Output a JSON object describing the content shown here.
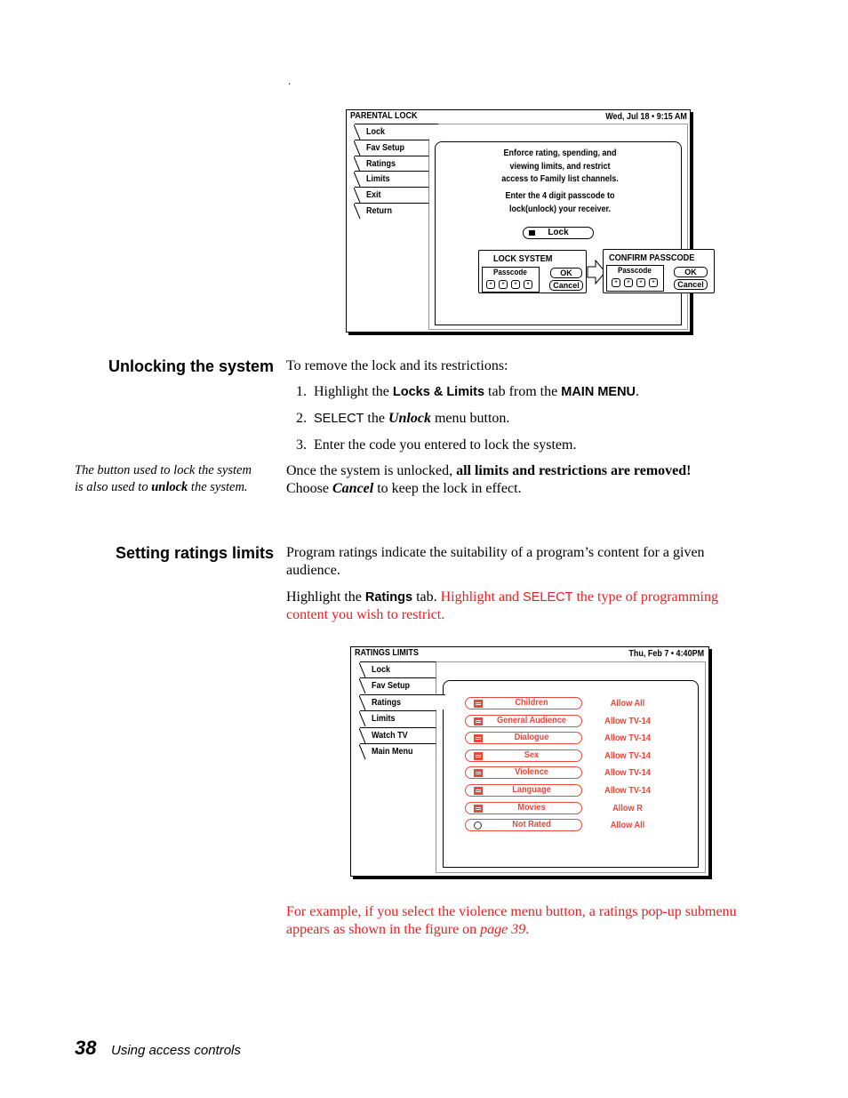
{
  "stray_mark": ".",
  "parental_lock_screen": {
    "title": "PARENTAL LOCK",
    "datetime": "Wed, Jul 18  •  9:15 AM",
    "tabs": [
      {
        "label": "Lock",
        "active": true
      },
      {
        "label": "Fav Setup"
      },
      {
        "label": "Ratings"
      },
      {
        "label": "Limits"
      },
      {
        "label": "Exit"
      },
      {
        "label": "Return"
      }
    ],
    "info_lines": [
      "Enforce rating, spending, and",
      "viewing limits, and restrict",
      "access to Family list channels."
    ],
    "passcode_lines": [
      "Enter the 4 digit passcode to",
      "lock(unlock) your receiver."
    ],
    "lock_button": "Lock",
    "lock_dialog": {
      "title": "LOCK SYSTEM",
      "passcode_label": "Passcode",
      "digits": [
        "*",
        "*",
        "*",
        "*"
      ],
      "ok": "OK",
      "cancel": "Cancel"
    },
    "confirm_dialog": {
      "title": "CONFIRM PASSCODE",
      "passcode_label": "Passcode",
      "digits": [
        "*",
        "*",
        "*",
        "*"
      ],
      "ok": "OK",
      "cancel": "Cancel"
    }
  },
  "unlocking": {
    "heading": "Unlocking the system",
    "intro": "To remove the lock and its restrictions:",
    "steps": {
      "s1": {
        "num": "1.",
        "a": "Highlight the ",
        "b": "Locks & Limits",
        "c": " tab from the ",
        "d": "MAIN MENU",
        "e": "."
      },
      "s2": {
        "num": "2.",
        "a": "SELECT",
        "b": " the ",
        "c": "Unlock",
        "d": " menu button."
      },
      "s3": {
        "num": "3.",
        "a": "Enter the code you entered to lock the system."
      }
    },
    "note_line1_a": "Once the system is unlocked, ",
    "note_line1_b": "all limits and restrictions are removed!",
    "note_line2_a": "Choose ",
    "note_line2_b": "Cancel",
    "note_line2_c": " to keep the lock in effect.",
    "sidenote_line1": "The button used to lock the system",
    "sidenote_line2_a": "is also used to ",
    "sidenote_line2_b": "unlock",
    "sidenote_line2_c": " the system."
  },
  "ratings_section": {
    "heading": "Setting ratings limits",
    "para1_line1": "Program ratings indicate the suitability of a program’s content for a given",
    "para1_line2": "audience.",
    "para2_a": "Highlight the ",
    "para2_b": "Ratings",
    "para2_c": " tab. ",
    "para2_d": "Highlight and ",
    "para2_e": "SELECT",
    "para2_f": " the type of programming",
    "para2_line2": "content you wish to restrict.",
    "example_line1": "For example, if you select the violence menu button, a ratings pop-up submenu",
    "example_line2_a": "appears as shown in the figure on ",
    "example_line2_b": "page 39",
    "example_line2_c": "."
  },
  "ratings_screen": {
    "title": "RATINGS LIMITS",
    "datetime": "Thu, Feb 7 •  4:40PM",
    "tabs": [
      {
        "label": "Lock"
      },
      {
        "label": "Fav Setup"
      },
      {
        "label": "Ratings",
        "active": true
      },
      {
        "label": "Limits"
      },
      {
        "label": "Watch TV"
      },
      {
        "label": "Main Menu"
      }
    ],
    "accent_color": "#e8473a",
    "rows": [
      {
        "label": "Children",
        "value": "Allow All",
        "icon": "list-icon"
      },
      {
        "label": "General Audience",
        "value": "Allow TV-14",
        "icon": "list-icon"
      },
      {
        "label": "Dialogue",
        "value": "Allow TV-14",
        "icon": "list-icon"
      },
      {
        "label": "Sex",
        "value": "Allow TV-14",
        "icon": "list-icon"
      },
      {
        "label": "Violence",
        "value": "Allow TV-14",
        "icon": "list-icon"
      },
      {
        "label": "Language",
        "value": "Allow TV-14",
        "icon": "list-icon"
      },
      {
        "label": "Movies",
        "value": "Allow R",
        "icon": "list-icon"
      },
      {
        "label": "Not Rated",
        "value": "Allow All",
        "icon": "refresh-icon"
      }
    ]
  },
  "footer": {
    "page_number": "38",
    "section_title": "Using access controls"
  }
}
